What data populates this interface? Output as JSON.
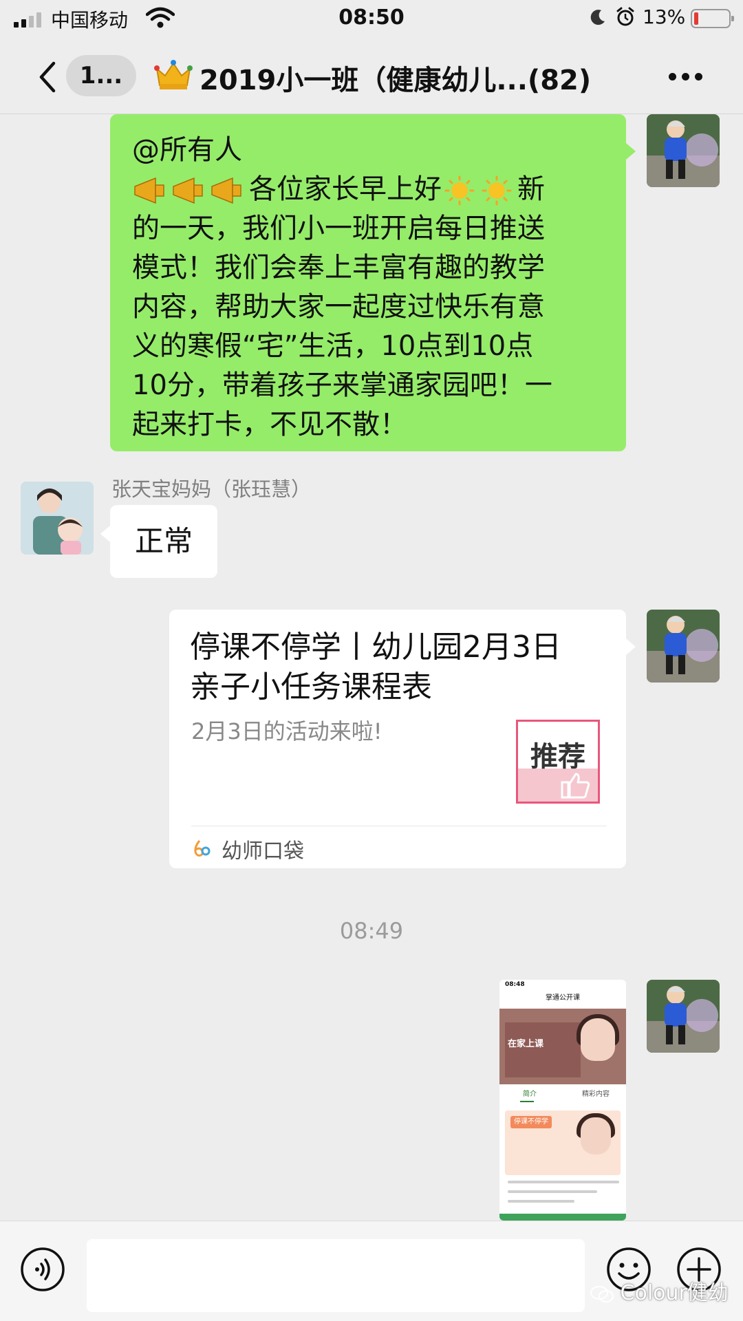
{
  "status_bar": {
    "carrier": "中国移动",
    "time": "08:50",
    "battery_percent": "13%",
    "battery_level": 0.13
  },
  "nav": {
    "unread_badge": "1...",
    "title": "2019小一班（健康幼儿...(82)",
    "crown_icon": "crown-icon",
    "more_icon": "more-icon"
  },
  "messages": {
    "announcement": {
      "lines": [
        "@所有人",
        "各位家长早上好",
        "新",
        "的一天，我们小一班开启每日推送",
        "模式！我们会奉上丰富有趣的教学",
        "内容，帮助大家一起度过快乐有意",
        "义的寒假“宅”生活，10点到10点",
        "10分，带着孩子来掌通家园吧！一",
        "起来打卡，不见不散！"
      ],
      "icons": [
        "megaphone-icon",
        "sun-icon"
      ]
    },
    "reply": {
      "sender": "张天宝妈妈（张珏慧）",
      "text": "正常"
    },
    "link_card": {
      "title_line1": "停课不停学丨幼儿园2月3日",
      "title_line2": "亲子小任务课程表",
      "description": "2月3日的活动来啦!",
      "thumb_tag": "推荐",
      "source": "幼师口袋"
    },
    "timestamp": "08:49",
    "screenshot": {
      "time": "08:48",
      "nav_title": "掌通公开课",
      "hero_text": "在家上课",
      "tab_intro": "简介",
      "tab_content": "精彩内容",
      "badge": "停课不停学"
    }
  },
  "input_bar": {
    "watermark": "Colour健幼"
  },
  "colors": {
    "chat_bg": "#ededed",
    "bubble_self": "#95ec69",
    "bubble_other": "#ffffff"
  }
}
